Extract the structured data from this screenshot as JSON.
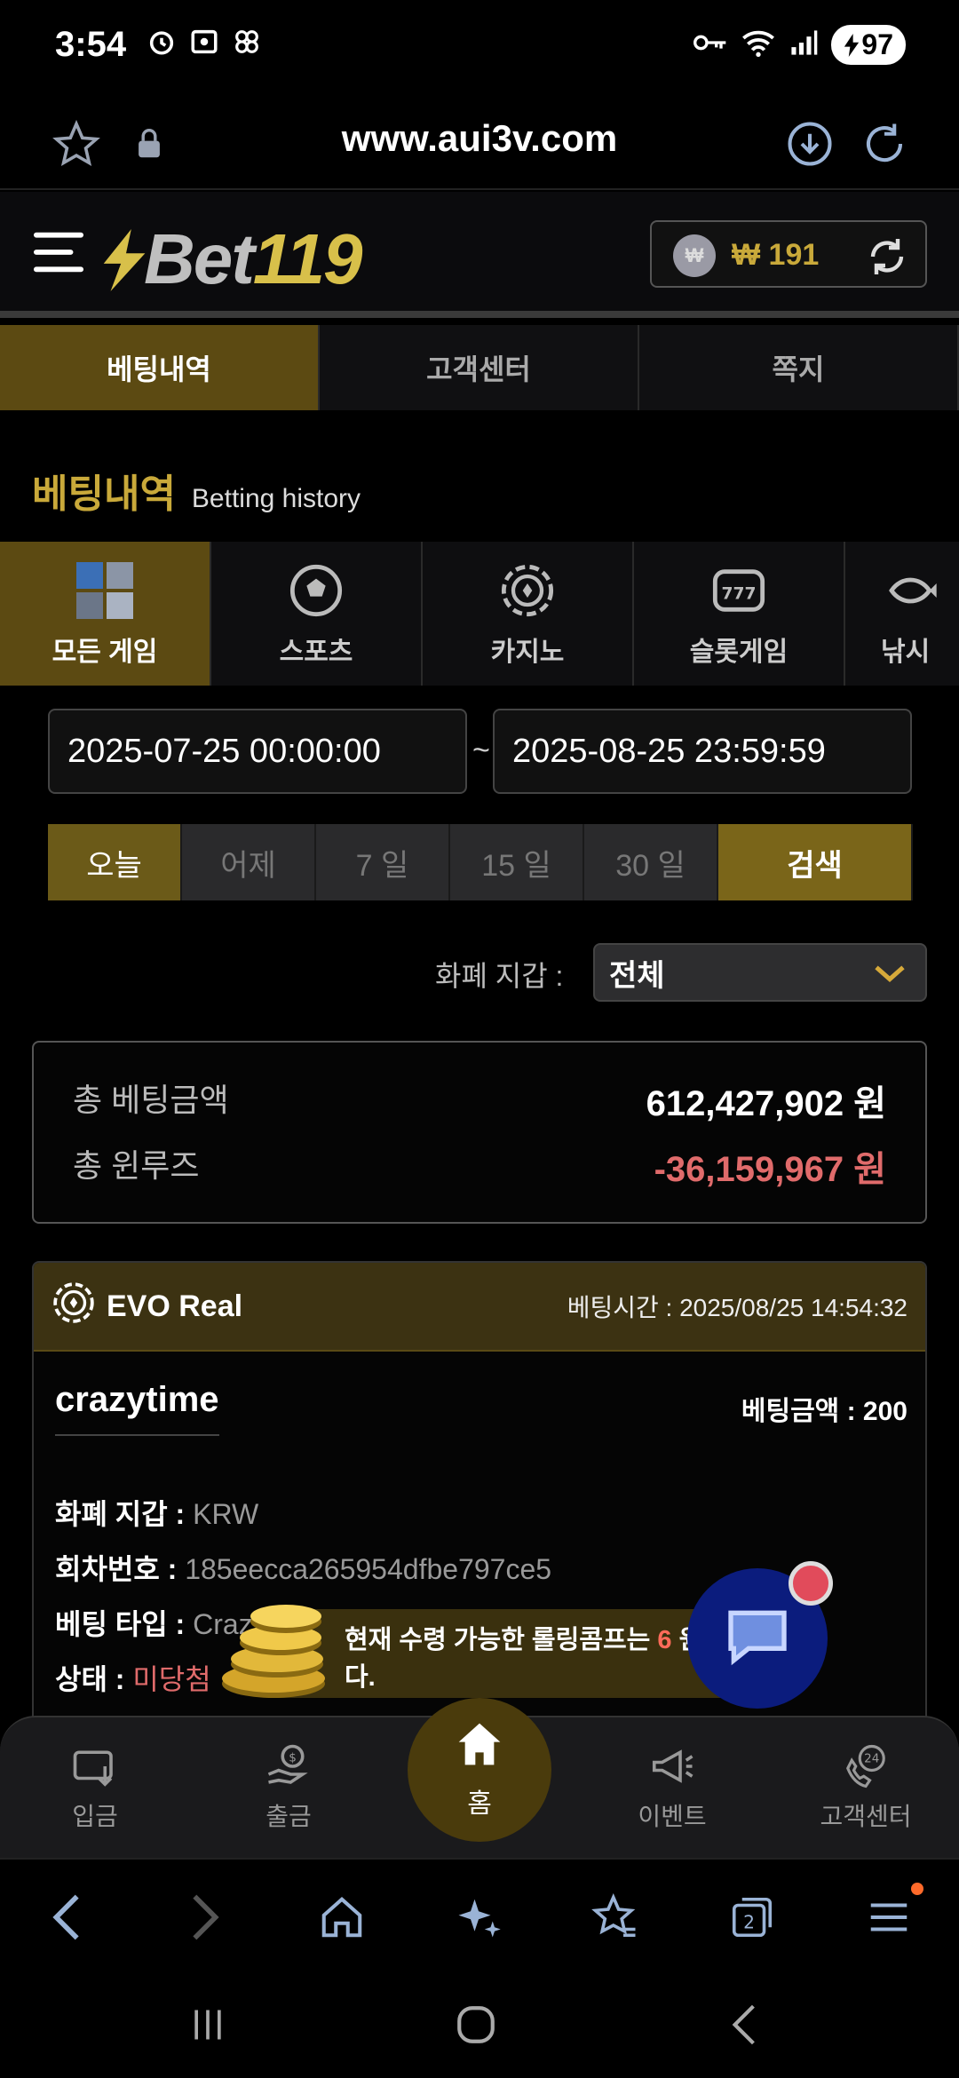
{
  "status_bar": {
    "time": "3:54",
    "battery": "97"
  },
  "browser": {
    "url": "www.aui3v.com"
  },
  "site": {
    "logo_main": "Bet",
    "logo_num": "119",
    "wallet_coin": "₩",
    "wallet_amount": "₩ 191"
  },
  "top_tabs": [
    "베팅내역",
    "고객센터",
    "쪽지"
  ],
  "page_title": {
    "ko": "베팅내역",
    "en": "Betting history"
  },
  "categories": [
    "모든 게임",
    "스포츠",
    "카지노",
    "슬롯게임",
    "낚시"
  ],
  "date_range": {
    "start": "2025-07-25 00:00:00",
    "separator": "~",
    "end": "2025-08-25 23:59:59"
  },
  "filters": [
    "오늘",
    "어제",
    "7 일",
    "15 일",
    "30 일"
  ],
  "search_label": "검색",
  "currency": {
    "label": "화폐 지갑 :",
    "selected": "전체"
  },
  "totals": {
    "bet_label": "총 베팅금액",
    "bet_value": "612,427,902 원",
    "winloss_label": "총 윈루즈",
    "winloss_value": "-36,159,967 원"
  },
  "bet_card": {
    "provider": "EVO Real",
    "time": "베팅시간 : 2025/08/25 14:54:32",
    "game": "crazytime",
    "amount": "베팅금액 : 200",
    "rows": [
      {
        "k": "화폐 지갑 :",
        "v": "KRW"
      },
      {
        "k": "회차번호 :",
        "v": "185eecca265954dfbe797ce5"
      },
      {
        "k": "베팅 타입 :",
        "v": "Crazy"
      },
      {
        "k": "상태 :",
        "v": "미당첨"
      }
    ]
  },
  "promo": {
    "pre": "현재 수령 가능한 롤링콤프는 ",
    "num": "6",
    "post": " 원",
    "line2": "다."
  },
  "site_nav": [
    "입금",
    "출금",
    "홈",
    "이벤트",
    "고객센터"
  ],
  "colors": {
    "gold": "#c9a93a",
    "tab_active": "#5c4a12",
    "negative": "#e06b6b",
    "chat": "#0b1c7d"
  }
}
